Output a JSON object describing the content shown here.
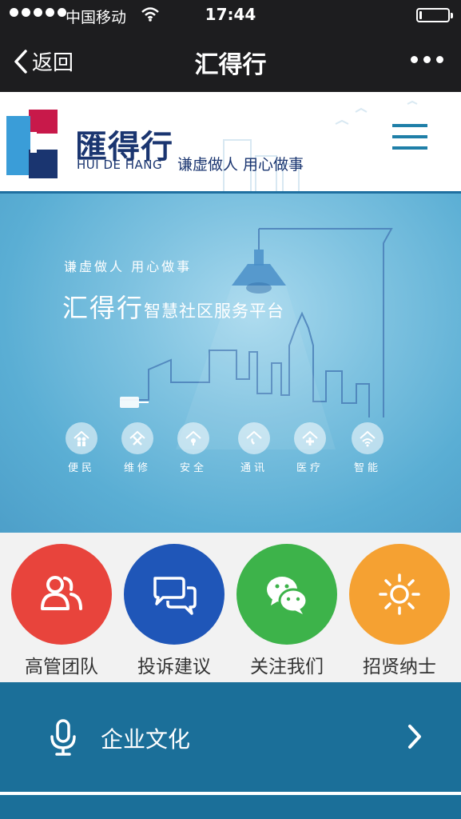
{
  "status_bar": {
    "carrier": "中国移动",
    "time": "17:44",
    "battery_level": 0.1
  },
  "nav": {
    "back_label": "返回",
    "title": "汇得行"
  },
  "header": {
    "logo_cn": "匯得行",
    "logo_en": "HUI DE HANG",
    "slogan": "谦虚做人 用心做事",
    "accent_color": "#1f7fa8",
    "logo_colors": [
      "#c8194a",
      "#3a9dd8",
      "#1a3570"
    ]
  },
  "banner": {
    "slogan": "谦虚做人  用心做事",
    "title_big": "汇得行",
    "title_small": "智慧社区服务平台",
    "services": [
      {
        "label": "便民",
        "icon": "people-icon"
      },
      {
        "label": "维修",
        "icon": "tools-icon"
      },
      {
        "label": "安全",
        "icon": "lock-icon"
      },
      {
        "label": "通讯",
        "icon": "phone-icon"
      },
      {
        "label": "医疗",
        "icon": "medical-cross-icon"
      },
      {
        "label": "智能",
        "icon": "wifi-icon"
      }
    ]
  },
  "quick_links": [
    {
      "label": "高管团队",
      "color": "#e8443c",
      "icon": "team-icon"
    },
    {
      "label": "投诉建议",
      "color": "#1f56b8",
      "icon": "chat-bubbles-icon"
    },
    {
      "label": "关注我们",
      "color": "#3db34a",
      "icon": "wechat-icon"
    },
    {
      "label": "招贤纳士",
      "color": "#f5a132",
      "icon": "sun-icon"
    }
  ],
  "menu": [
    {
      "label": "企业文化",
      "icon": "microphone-icon"
    }
  ],
  "menu_color": "#1b6f99"
}
